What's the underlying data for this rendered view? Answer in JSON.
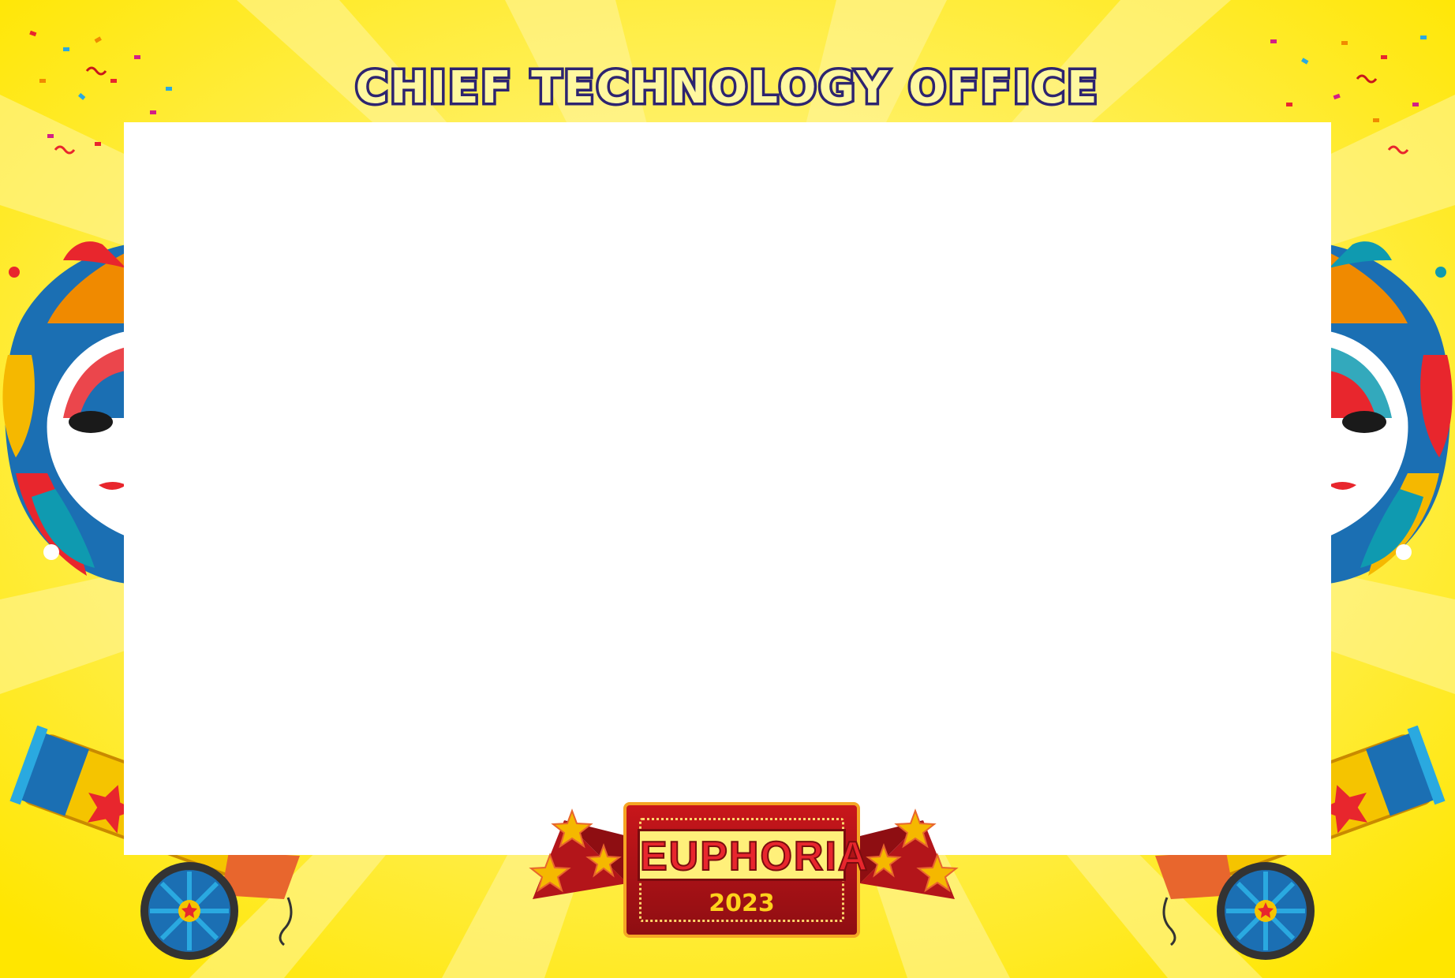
{
  "title": "CHIEF TECHNOLOGY OFFICE",
  "badge": {
    "title": "EUPHORIA",
    "year": "2023"
  },
  "colors": {
    "background": "#ffe90f",
    "title_fill": "#fff8a0",
    "title_outline": "#2d2470",
    "photo_area": "#ffffff",
    "badge_red": "#c8161b",
    "badge_gold": "#f5a524"
  },
  "decorations": [
    "carnival-mask-left",
    "carnival-mask-right",
    "cannon-left",
    "cannon-right",
    "confetti",
    "star-burst-left",
    "star-burst-right"
  ]
}
